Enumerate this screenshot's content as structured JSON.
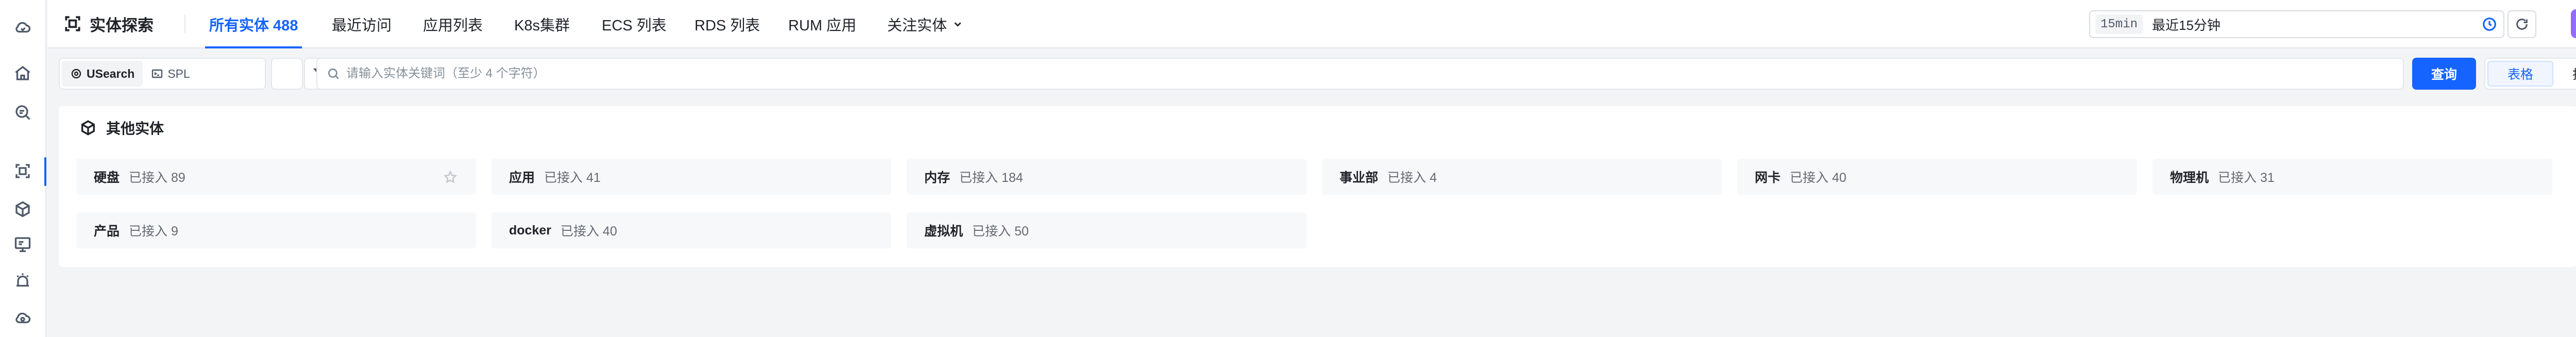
{
  "rail": {
    "icons": [
      "cloud-sync-icon",
      "home-icon",
      "search-doc-icon",
      "entity-explore-icon",
      "cube-icon",
      "monitor-icon",
      "alarm-icon",
      "cloud-icon"
    ],
    "active_index": 3
  },
  "header": {
    "title": "实体探索",
    "tabs": [
      {
        "label": "所有实体 488",
        "active": true
      },
      {
        "label": "最近访问"
      },
      {
        "label": "应用列表"
      },
      {
        "label": "K8s集群"
      },
      {
        "label": "ECS 列表"
      },
      {
        "label": "RDS 列表"
      },
      {
        "label": "RUM 应用"
      },
      {
        "label": "关注实体",
        "dropdown": true
      }
    ],
    "time": {
      "range": "15min",
      "label": "最近15分钟"
    }
  },
  "search": {
    "modes": [
      "USearch",
      "SPL"
    ],
    "active_mode": "USearch",
    "placeholder": "请输入实体关键词（至少 4 个字符）",
    "value": "",
    "query_button": "查询",
    "views": [
      "表格",
      "拓扑"
    ],
    "active_view": "表格"
  },
  "group": {
    "title": "其他实体",
    "items": [
      {
        "name": "硬盘",
        "count": "已接入 89"
      },
      {
        "name": "应用",
        "count": "已接入 41"
      },
      {
        "name": "内存",
        "count": "已接入 184"
      },
      {
        "name": "事业部",
        "count": "已接入 4"
      },
      {
        "name": "网卡",
        "count": "已接入 40"
      },
      {
        "name": "物理机",
        "count": "已接入 31"
      },
      {
        "name": "产品",
        "count": "已接入 9"
      },
      {
        "name": "docker",
        "count": "已接入 40"
      },
      {
        "name": "虚拟机",
        "count": "已接入 50"
      }
    ]
  },
  "colors": {
    "accent": "#1664ff",
    "ai_gradient_start": "#8f6bff",
    "ai_gradient_end": "#b482ff"
  }
}
